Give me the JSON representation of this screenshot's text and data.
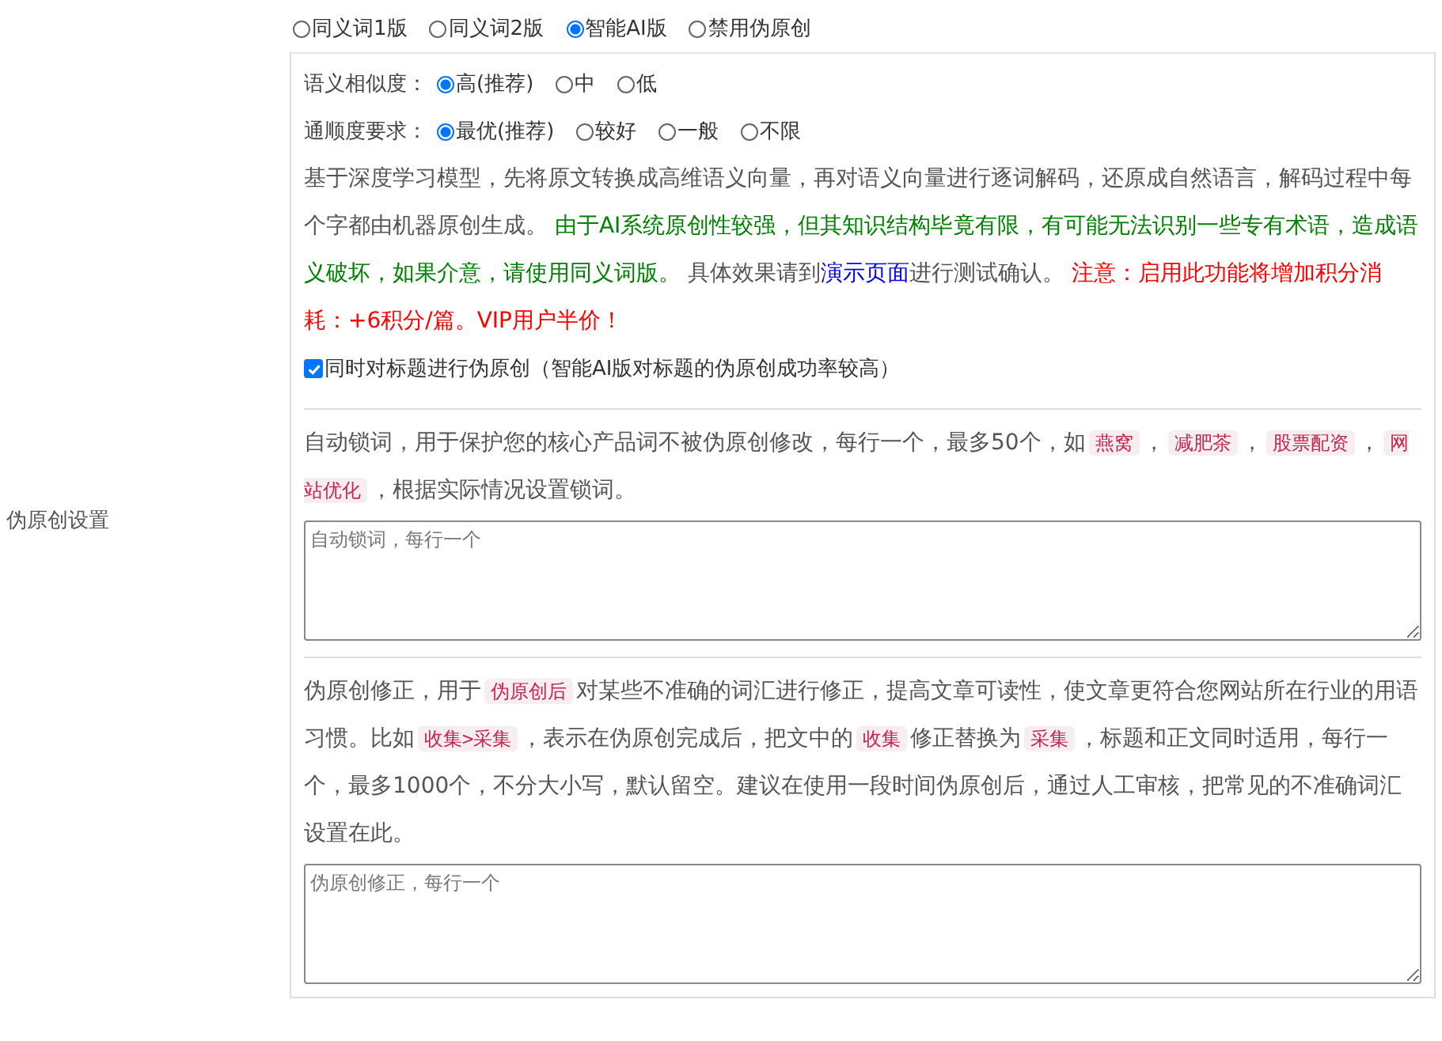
{
  "mode_options": [
    {
      "label": "同义词1版",
      "selected": false
    },
    {
      "label": "同义词2版",
      "selected": false
    },
    {
      "label": "智能AI版",
      "selected": true
    },
    {
      "label": "禁用伪原创",
      "selected": false
    }
  ],
  "ai_settings": {
    "similarity": {
      "label": "语义相似度：",
      "options": [
        {
          "label": "高(推荐)",
          "selected": true
        },
        {
          "label": "中",
          "selected": false
        },
        {
          "label": "低",
          "selected": false
        }
      ]
    },
    "fluency": {
      "label": "通顺度要求：",
      "options": [
        {
          "label": "最优(推荐)",
          "selected": true
        },
        {
          "label": "较好",
          "selected": false
        },
        {
          "label": "一般",
          "selected": false
        },
        {
          "label": "不限",
          "selected": false
        }
      ]
    },
    "description": [
      {
        "kind": "plain",
        "text": "基于深度学习模型，先将原文转换成高维语义向量，再对语义向量进行逐词解码，还原成自然语言，解码过程中每个字都由机器原创生成。 "
      },
      {
        "kind": "notice",
        "text": "由于AI系统原创性较强，但其知识结构毕竟有限，有可能无法识别一些专有术语，造成语义破坏，如果介意，请使用同义词版。"
      },
      {
        "kind": "plain",
        "text": " 具体效果请到"
      },
      {
        "kind": "link",
        "text": "演示页面"
      },
      {
        "kind": "plain",
        "text": "进行测试确认。 "
      },
      {
        "kind": "warning",
        "text": "注意：启用此功能将增加积分消耗：+6积分/篇。VIP用户半价！"
      }
    ],
    "title_option": {
      "label": "同时对标题进行伪原创（智能AI版对标题的伪原创成功率较高）",
      "checked": true
    }
  },
  "side_label": "伪原创设置",
  "lock_words": {
    "description": [
      {
        "kind": "plain",
        "text": "自动锁词，用于保护您的核心产品词不被伪原创修改，每行一个，最多50个，如"
      },
      {
        "kind": "code",
        "text": "燕窝"
      },
      {
        "kind": "plain",
        "text": "，"
      },
      {
        "kind": "code",
        "text": "减肥茶"
      },
      {
        "kind": "plain",
        "text": "，"
      },
      {
        "kind": "code",
        "text": "股票配资"
      },
      {
        "kind": "plain",
        "text": "，"
      },
      {
        "kind": "code",
        "text": "网站优化"
      },
      {
        "kind": "plain",
        "text": "，根据实际情况设置锁词。"
      }
    ],
    "placeholder": "自动锁词，每行一个"
  },
  "corrections": {
    "description": [
      {
        "kind": "plain",
        "text": "伪原创修正，用于"
      },
      {
        "kind": "code",
        "text": "伪原创后"
      },
      {
        "kind": "plain",
        "text": "对某些不准确的词汇进行修正，提高文章可读性，使文章更符合您网站所在行业的用语习惯。比如"
      },
      {
        "kind": "code",
        "text": "收集>采集"
      },
      {
        "kind": "plain",
        "text": "，表示在伪原创完成后，把文中的"
      },
      {
        "kind": "code",
        "text": "收集"
      },
      {
        "kind": "plain",
        "text": "修正替换为"
      },
      {
        "kind": "code",
        "text": "采集"
      },
      {
        "kind": "plain",
        "text": "，标题和正文同时适用，每行一个，最多1000个，不分大小写，默认留空。建议在使用一段时间伪原创后，通过人工审核，把常见的不准确词汇设置在此。"
      }
    ],
    "placeholder": "伪原创修正，每行一个"
  }
}
